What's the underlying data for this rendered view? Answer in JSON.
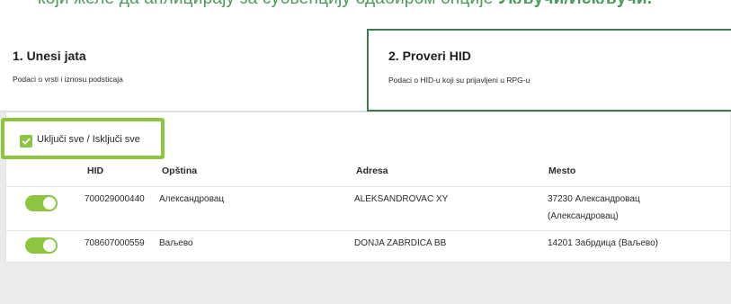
{
  "banner": {
    "text_prefix": "који желе да аплицирају за субвенцију одабиром опције ",
    "text_bold": "Укључи/Искључи."
  },
  "steps": [
    {
      "title": "1. Unesi jata",
      "subtitle": "Podaci o vrsti i iznosu podsticaja",
      "active": false
    },
    {
      "title": "2. Proveri HID",
      "subtitle": "Podaci o HID-u koji su prijavljeni u RPG-u",
      "active": true
    }
  ],
  "toggle_all": {
    "label": "Uključi sve / Isključi sve",
    "checked": true
  },
  "table": {
    "headers": [
      "HID",
      "Opština",
      "Adresa",
      "Mesto"
    ],
    "rows": [
      {
        "enabled": true,
        "hid": "700029000440",
        "opstina": "Александровац",
        "adresa": "ALEKSANDROVAC XY",
        "mesto_line1": "37230 Александровац",
        "mesto_line2": "(Александровац)"
      },
      {
        "enabled": true,
        "hid": "708607000559",
        "opstina": "Ваљево",
        "adresa": "DONJA ZABRDICA BB",
        "mesto_line1": "14201 Забрдица (Ваљево)",
        "mesto_line2": ""
      }
    ]
  },
  "colors": {
    "accent_green": "#8cc63f",
    "dark_green_border": "#3d7a52",
    "banner_text": "#4a9a5a"
  }
}
